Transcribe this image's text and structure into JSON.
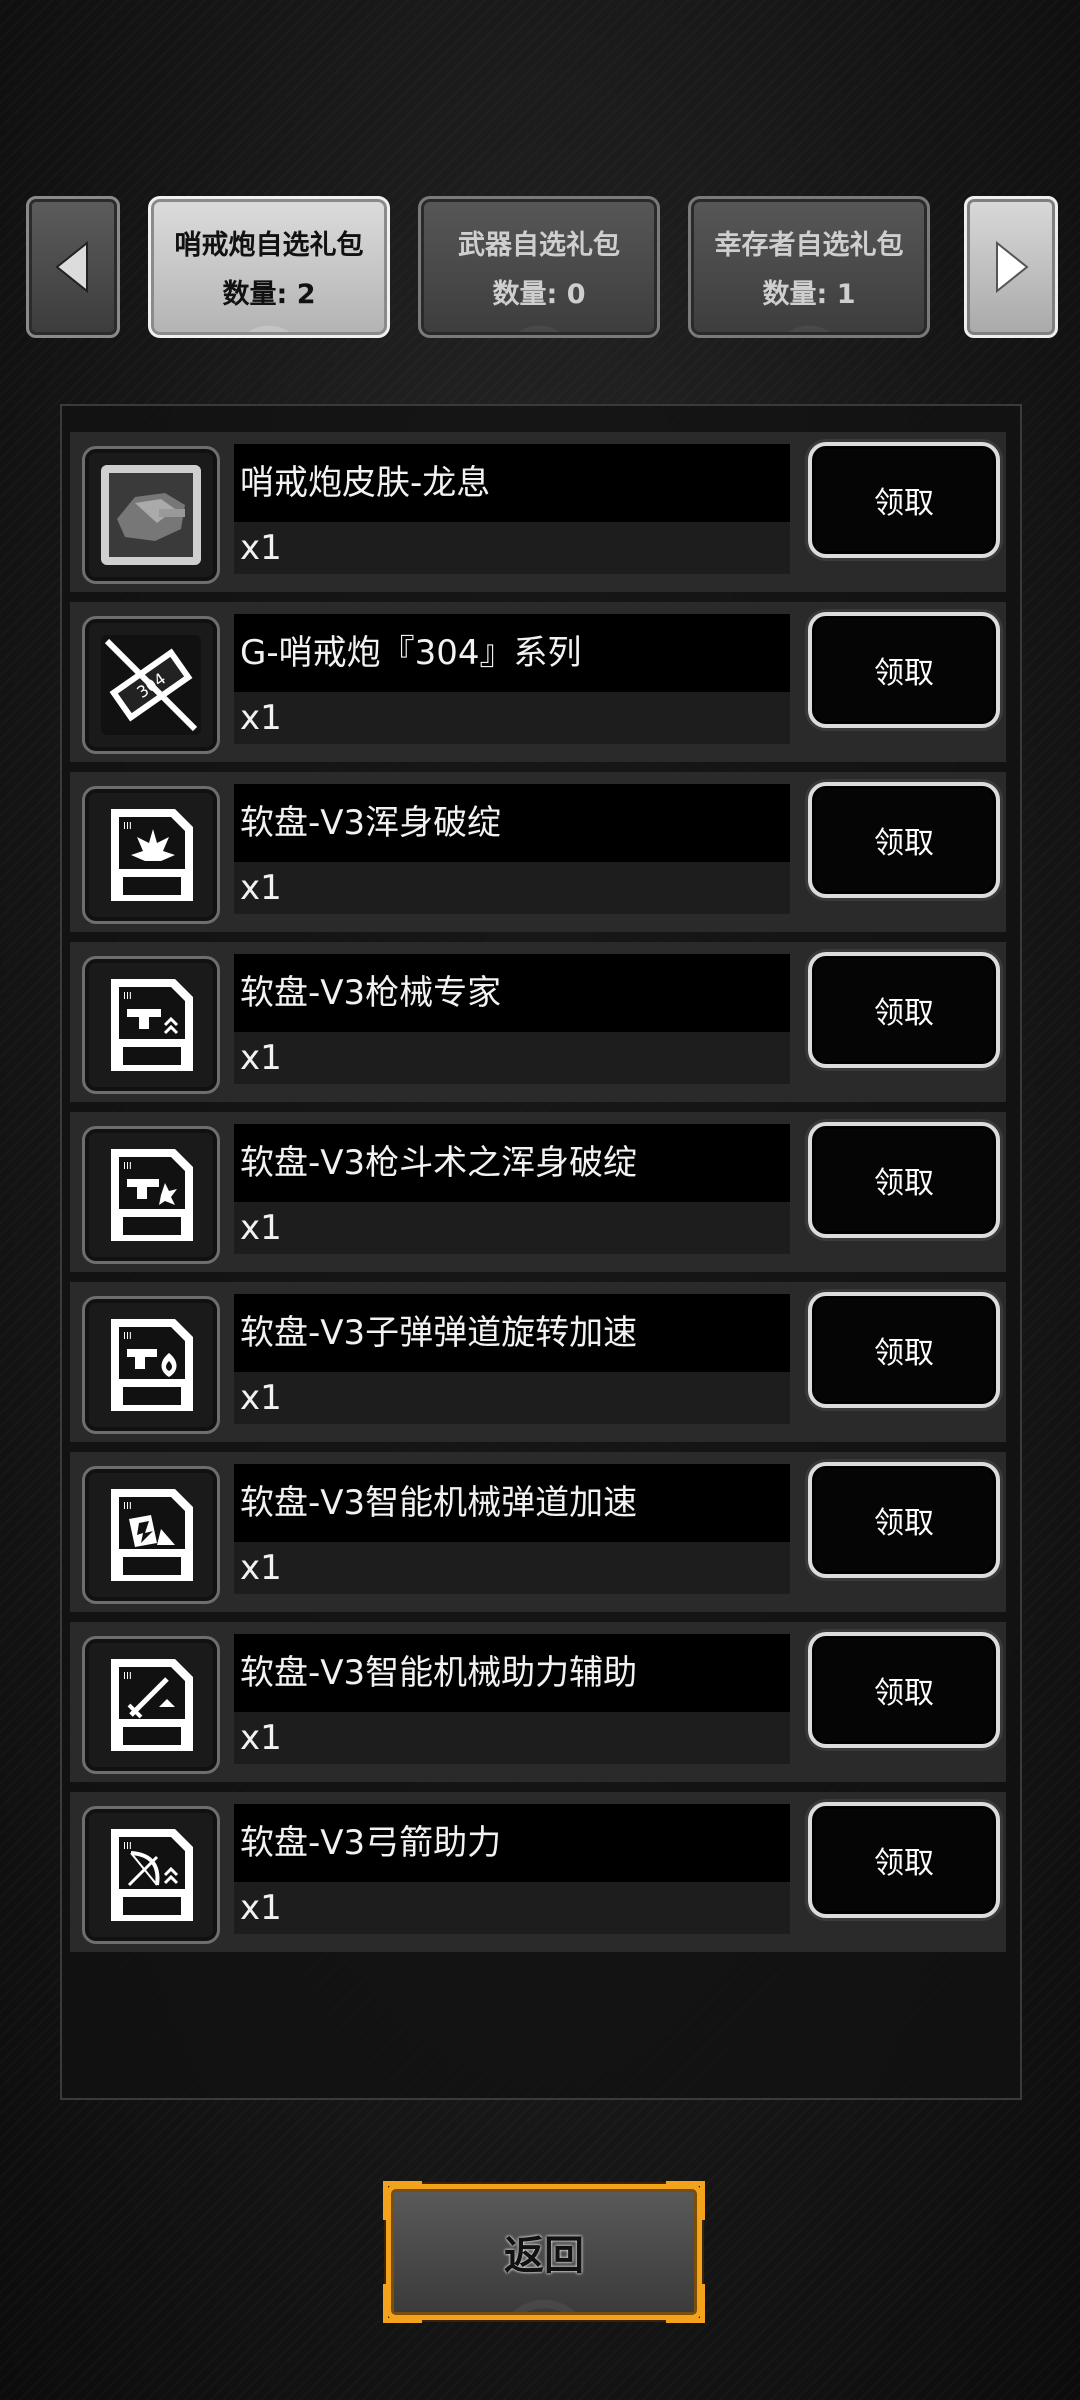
{
  "tabs": [
    {
      "title": "哨戒炮自选礼包",
      "count": "数量: 2",
      "active": true
    },
    {
      "title": "武器自选礼包",
      "count": "数量: 0",
      "active": false
    },
    {
      "title": "幸存者自选礼包",
      "count": "数量: 1",
      "active": false
    }
  ],
  "items": [
    {
      "name": "哨戒炮皮肤-龙息",
      "qty": "x1",
      "claim": "领取",
      "icon": "turret-skin-icon"
    },
    {
      "name": "G-哨戒炮『304』系列",
      "qty": "x1",
      "claim": "领取",
      "icon": "turret-304-icon"
    },
    {
      "name": "软盘-V3浑身破绽",
      "qty": "x1",
      "claim": "领取",
      "icon": "floppy-burst-icon"
    },
    {
      "name": "软盘-V3枪械专家",
      "qty": "x1",
      "claim": "领取",
      "icon": "floppy-gun-expert-icon"
    },
    {
      "name": "软盘-V3枪斗术之浑身破绽",
      "qty": "x1",
      "claim": "领取",
      "icon": "floppy-gun-kata-icon"
    },
    {
      "name": "软盘-V3子弹弹道旋转加速",
      "qty": "x1",
      "claim": "领取",
      "icon": "floppy-bullet-spin-icon"
    },
    {
      "name": "软盘-V3智能机械弹道加速",
      "qty": "x1",
      "claim": "领取",
      "icon": "floppy-smart-mech-icon"
    },
    {
      "name": "软盘-V3智能机械助力辅助",
      "qty": "x1",
      "claim": "领取",
      "icon": "floppy-mech-assist-icon"
    },
    {
      "name": "软盘-V3弓箭助力",
      "qty": "x1",
      "claim": "领取",
      "icon": "floppy-bow-assist-icon"
    }
  ],
  "back_label": "返回",
  "colors": {
    "accent": "#f2a21b",
    "panel": "#2a2a2a",
    "active_tab": "#dcdcdc"
  }
}
